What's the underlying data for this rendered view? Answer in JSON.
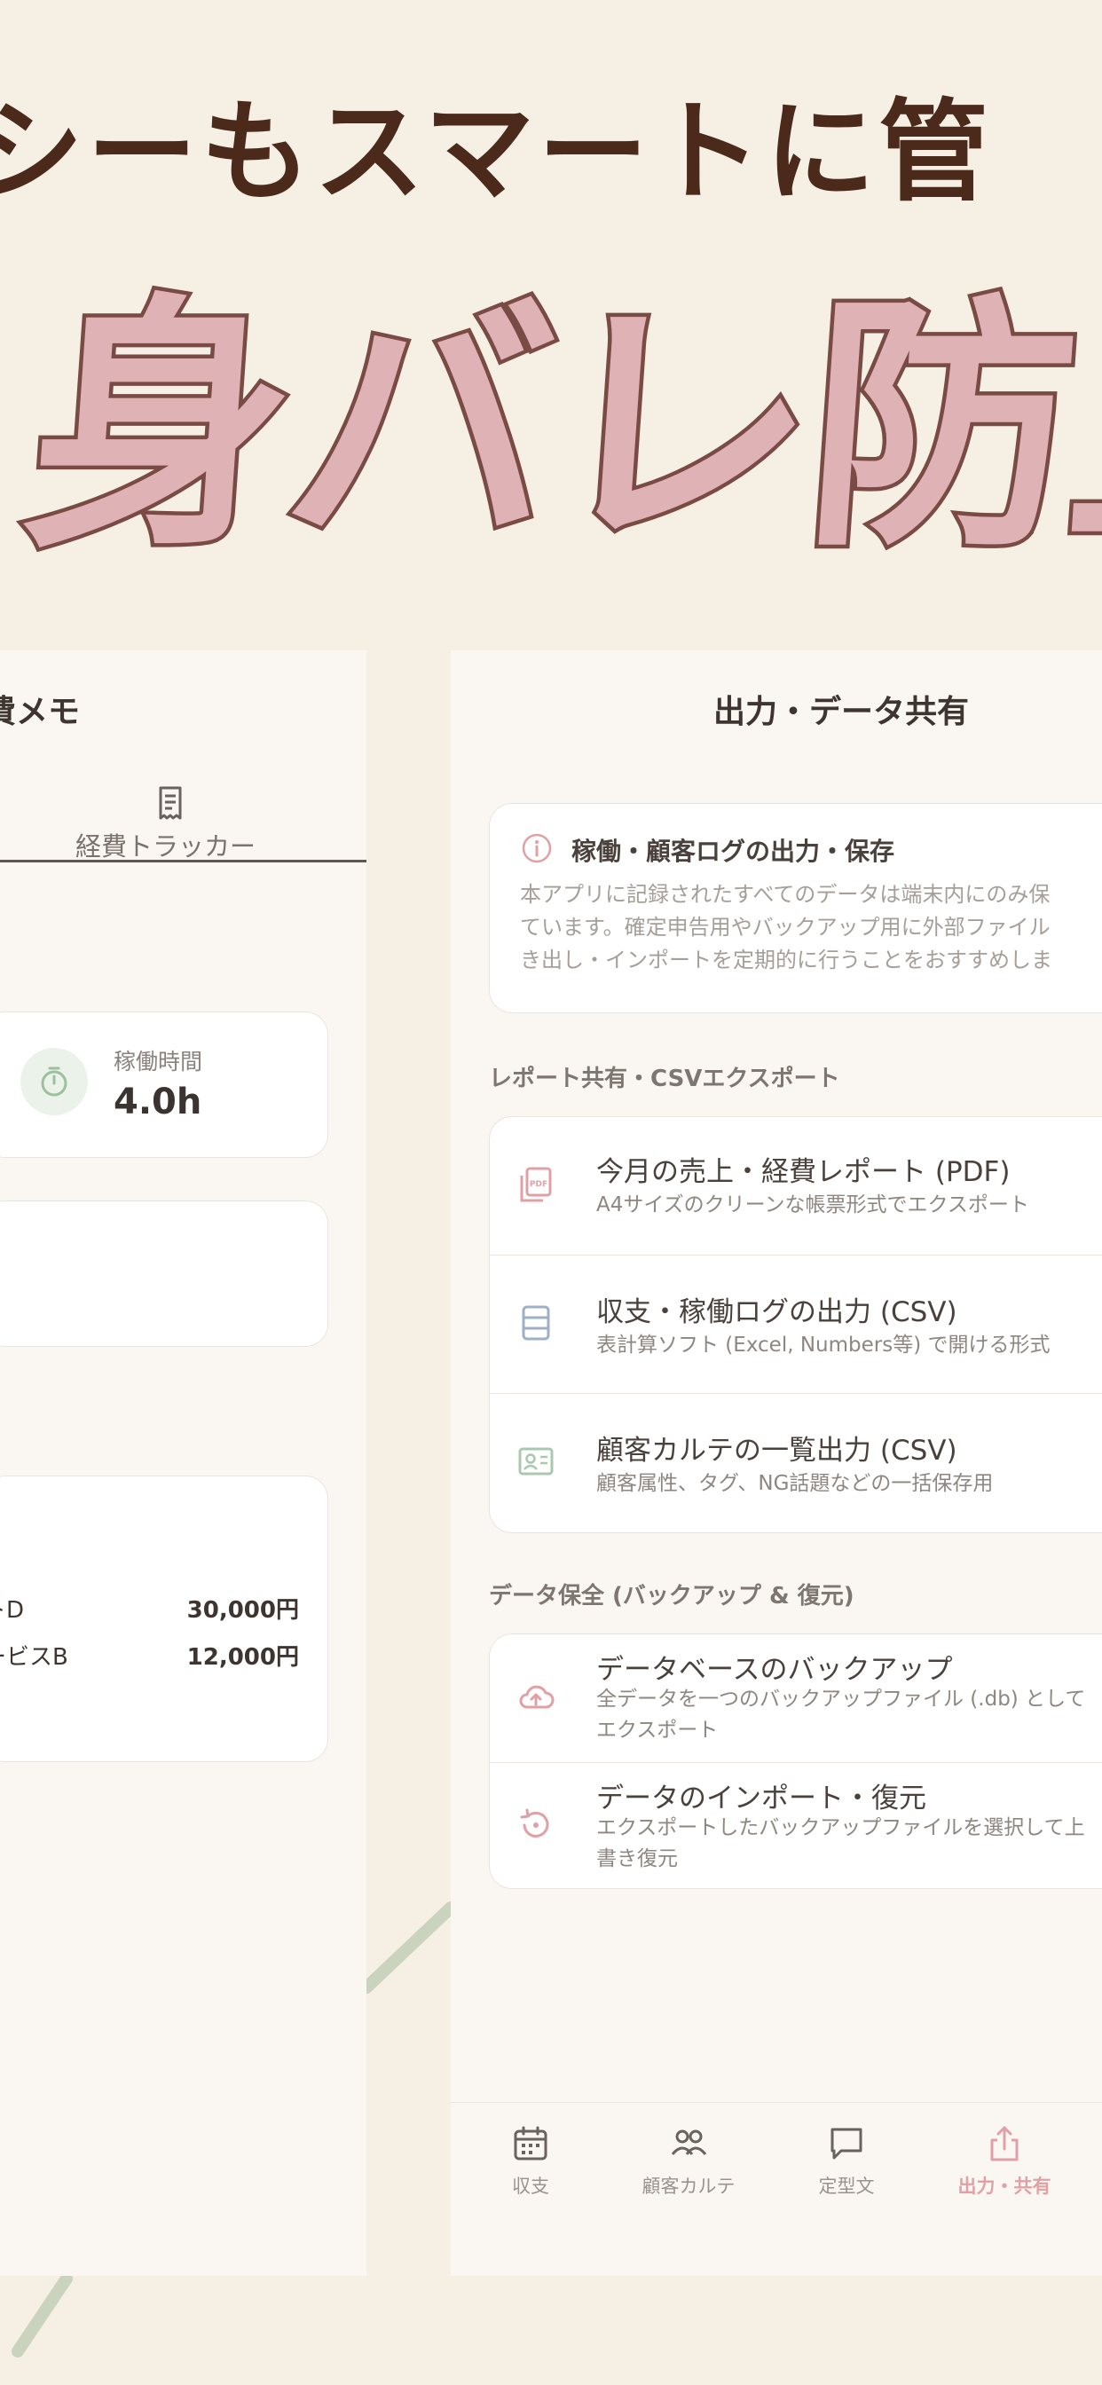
{
  "headline": {
    "top": "シーもスマートに管",
    "big": "身バレ防止"
  },
  "left_panel": {
    "title": "費メモ",
    "tab_label": "経費トラッカー",
    "work_time_label": "稼働時間",
    "work_time_value": "4.0h",
    "expenses": [
      {
        "name": "トD",
        "amount": "30,000円"
      },
      {
        "name": "ービスB",
        "amount": "12,000円"
      }
    ]
  },
  "right_panel": {
    "title": "出力・データ共有",
    "info_card": {
      "heading": "稼働・顧客ログの出力・保存",
      "body_lines": [
        "本アプリに記録されたすべてのデータは端末内にのみ保",
        "ています。確定申告用やバックアップ用に外部ファイル",
        "き出し・インポートを定期的に行うことをおすすめしま"
      ]
    },
    "report_section_label": "レポート共有・CSVエクスポート",
    "report_items": [
      {
        "icon": "pdf-icon",
        "title": "今月の売上・経費レポート (PDF)",
        "subtitle": "A4サイズのクリーンな帳票形式でエクスポート"
      },
      {
        "icon": "list-document-icon",
        "title": "収支・稼働ログの出力 (CSV)",
        "subtitle": "表計算ソフト (Excel, Numbers等) で開ける形式"
      },
      {
        "icon": "contact-card-icon",
        "title": "顧客カルテの一覧出力 (CSV)",
        "subtitle": "顧客属性、タグ、NG話題などの一括保存用"
      }
    ],
    "backup_section_label": "データ保全 (バックアップ & 復元)",
    "backup_items": [
      {
        "icon": "cloud-upload-icon",
        "title": "データベースのバックアップ",
        "subtitle": "全データを一つのバックアップファイル (.db) としてエクスポート"
      },
      {
        "icon": "restore-icon",
        "title": "データのインポート・復元",
        "subtitle": "エクスポートしたバックアップファイルを選択して上書き復元"
      }
    ]
  },
  "bottom_nav": [
    {
      "label": "収支",
      "icon": "calendar-icon",
      "active": false
    },
    {
      "label": "顧客カルテ",
      "icon": "people-icon",
      "active": false
    },
    {
      "label": "定型文",
      "icon": "chat-bubble-icon",
      "active": false
    },
    {
      "label": "出力・共有",
      "icon": "share-icon",
      "active": true
    }
  ],
  "colors": {
    "background": "#f5f0e3",
    "headline_brown": "#4b2a1c",
    "headline_pink": "#dfb2b6",
    "accent_pink": "#e0a0a6",
    "accent_green": "#a9c8ad",
    "accent_blue": "#9eb0c8"
  }
}
